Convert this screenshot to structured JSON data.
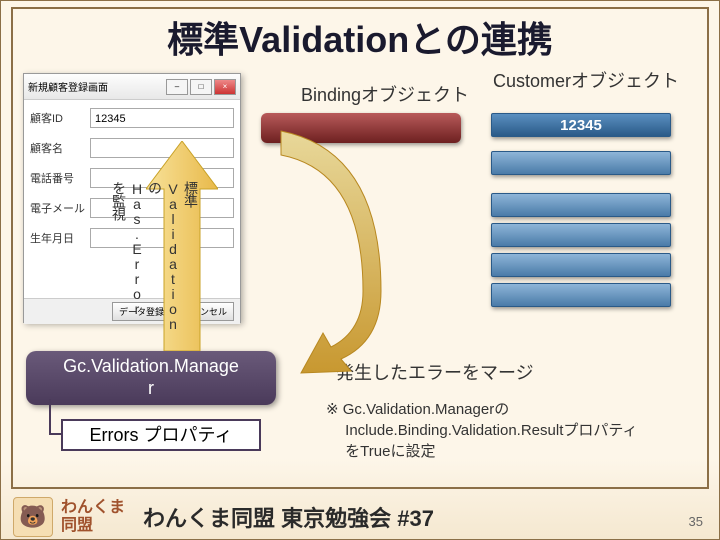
{
  "title": "標準Validationとの連携",
  "dialog": {
    "window_title": "新規顧客登録画面",
    "rows": [
      {
        "label": "顧客ID",
        "value": "12345"
      },
      {
        "label": "顧客名",
        "value": ""
      },
      {
        "label": "電話番号",
        "value": ""
      },
      {
        "label": "電子メール",
        "value": ""
      },
      {
        "label": "生年月日",
        "value": ""
      }
    ],
    "footer": {
      "register": "データ登録",
      "cancel": "キャンセル"
    }
  },
  "vertical_arrow_label": "標準Validationの\nHas.Errorを監視",
  "binding_label": "Bindingオブジェクト",
  "customer_label": "Customerオブジェクト",
  "customer_value": "12345",
  "gc_manager": "Gc.Validation.Manage\nr",
  "errors_prop": "Errors プロパティ",
  "merge_text": "発生したエラーをマージ",
  "note_text": "※ Gc.Validation.Managerの\n　 Include.Binding.Validation.Resultプロパティ\n　 をTrueに設定",
  "footer": {
    "brand": "わんくま\n同盟",
    "session": "わんくま同盟 東京勉強会 #37",
    "page": "35"
  },
  "colors": {
    "title": "#1a1a2e",
    "arrow_fill": "#f4d26a",
    "arrow_stroke": "#c9a227",
    "curved_start": "#d9c27a",
    "curved_end": "#b88820"
  }
}
